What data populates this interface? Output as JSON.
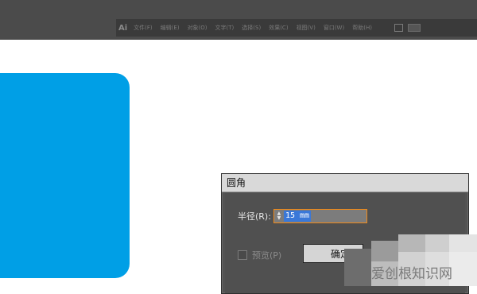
{
  "menubar": {
    "logo": "Ai",
    "items": [
      "文件(F)",
      "编辑(E)",
      "对象(O)",
      "文字(T)",
      "选择(S)",
      "效果(C)",
      "视图(V)",
      "窗口(W)",
      "帮助(H)"
    ]
  },
  "dialog": {
    "title": "圆角",
    "radius_label": "半径(R):",
    "radius_value": "15 mm",
    "preview_label": "预览(P)",
    "preview_checked": false,
    "ok_label": "确定"
  },
  "watermark": "爱创根知识网",
  "colors": {
    "shape_fill": "#009fe6",
    "field_focus": "#f08a19",
    "selection": "#3a78d8"
  },
  "icons": [
    "spin-up-icon",
    "spin-down-icon",
    "checkbox-icon"
  ]
}
